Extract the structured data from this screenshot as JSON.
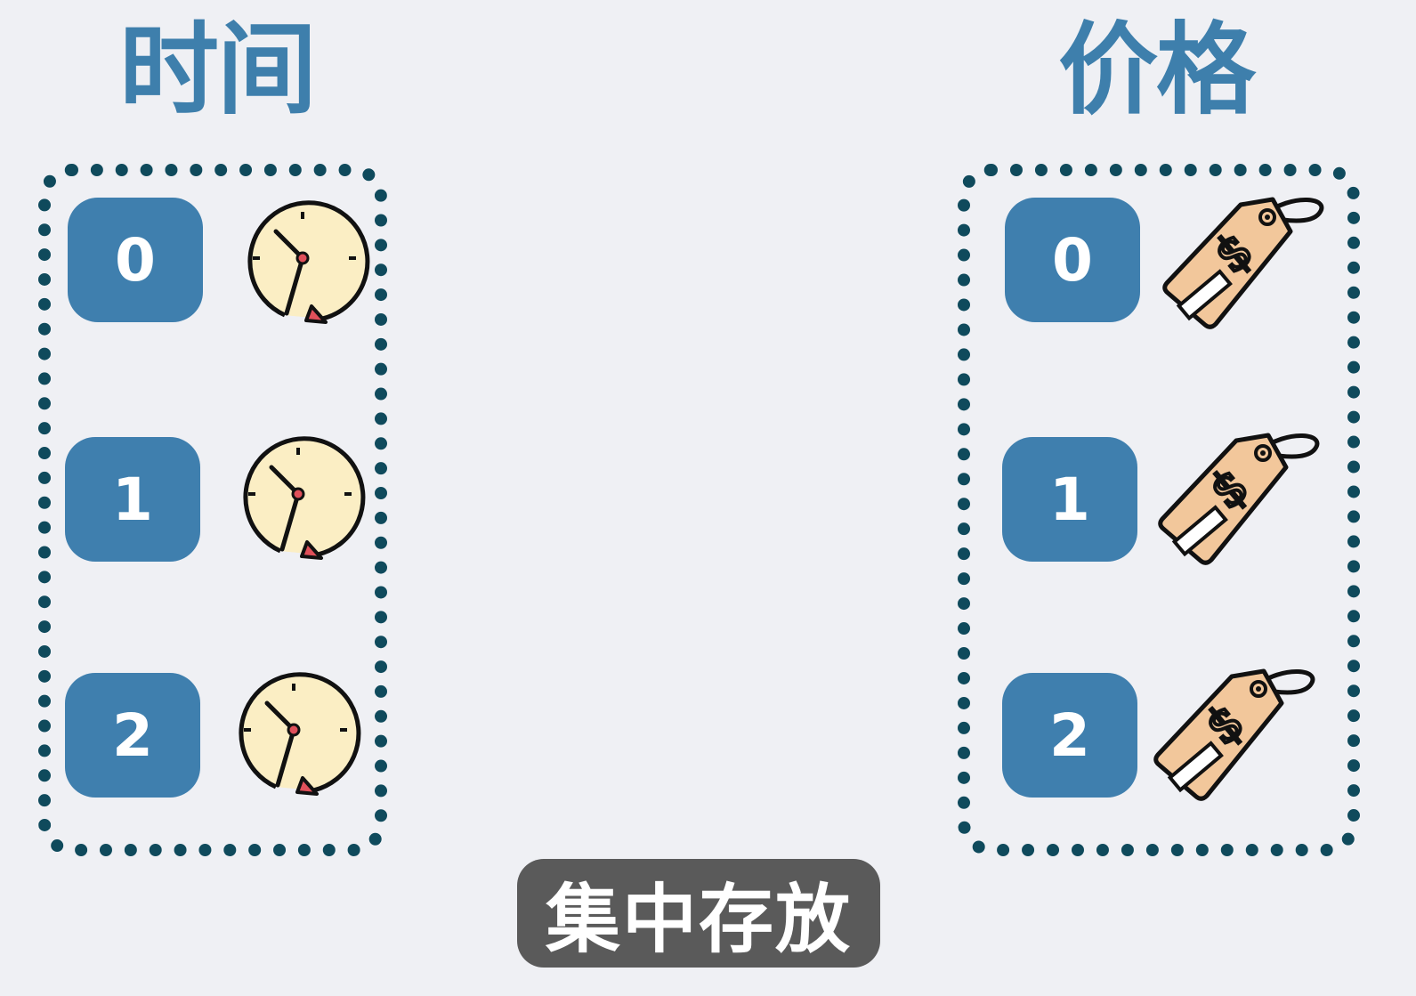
{
  "headings": {
    "time": "时间",
    "price": "价格"
  },
  "time_group": {
    "items": [
      {
        "index": "0",
        "icon": "clock-icon"
      },
      {
        "index": "1",
        "icon": "clock-icon"
      },
      {
        "index": "2",
        "icon": "clock-icon"
      }
    ]
  },
  "price_group": {
    "items": [
      {
        "index": "0",
        "icon": "price-tag-icon"
      },
      {
        "index": "1",
        "icon": "price-tag-icon"
      },
      {
        "index": "2",
        "icon": "price-tag-icon"
      }
    ]
  },
  "caption": "集中存放",
  "colors": {
    "background": "#eff0f4",
    "heading": "#3e7fac",
    "badge": "#3f7fae",
    "dotted_border": "#0f4a5c",
    "caption_bg": "#5a5a5a",
    "clock_face": "#fbeec4",
    "tag_fill": "#f2c79b",
    "arrow_red": "#e0505a"
  }
}
